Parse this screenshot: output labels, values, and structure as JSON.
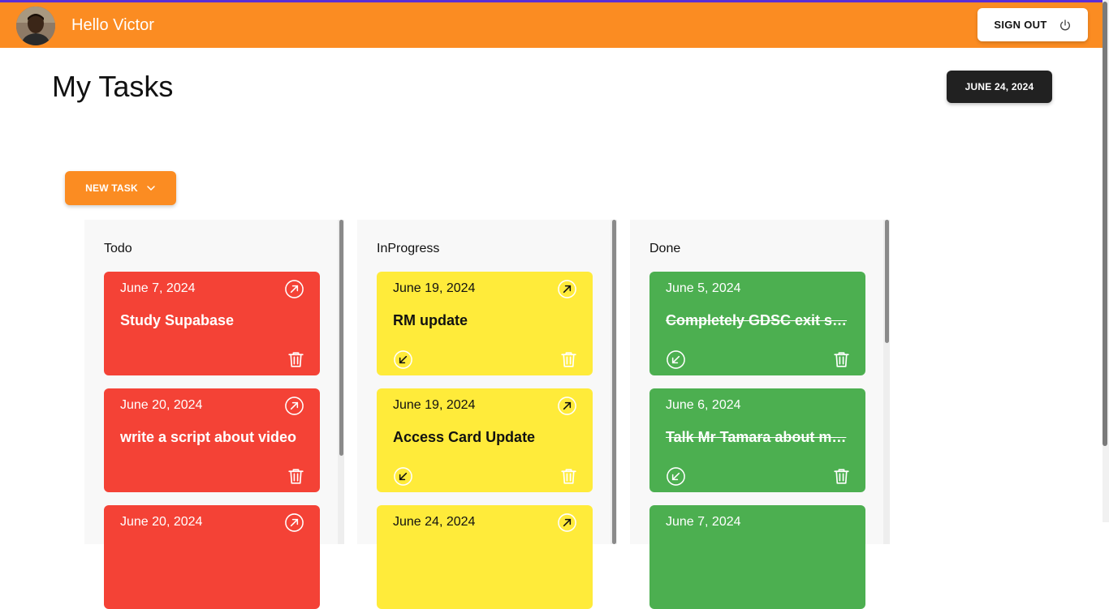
{
  "header": {
    "greeting": "Hello Victor",
    "sign_out_label": "SIGN OUT",
    "accent_color": "#fb8c22"
  },
  "page": {
    "title": "My Tasks",
    "date_label": "JUNE 24, 2024",
    "new_task_label": "NEW TASK"
  },
  "columns": [
    {
      "title": "Todo",
      "color": "#f44236",
      "cards": [
        {
          "date": "June 7, 2024",
          "title": "Study Supabase"
        },
        {
          "date": "June 20, 2024",
          "title": "write a script about video"
        },
        {
          "date": "June 20, 2024",
          "title": ""
        }
      ]
    },
    {
      "title": "InProgress",
      "color": "#ffeb3a",
      "cards": [
        {
          "date": "June 19, 2024",
          "title": "RM update"
        },
        {
          "date": "June 19, 2024",
          "title": "Access Card Update"
        },
        {
          "date": "June 24, 2024",
          "title": ""
        }
      ]
    },
    {
      "title": "Done",
      "color": "#4caf50",
      "cards": [
        {
          "date": "June 5, 2024",
          "title": "Completely GDSC exit s…"
        },
        {
          "date": "June 6, 2024",
          "title": "Talk Mr Tamara about m…"
        },
        {
          "date": "June 7, 2024",
          "title": ""
        }
      ]
    }
  ]
}
